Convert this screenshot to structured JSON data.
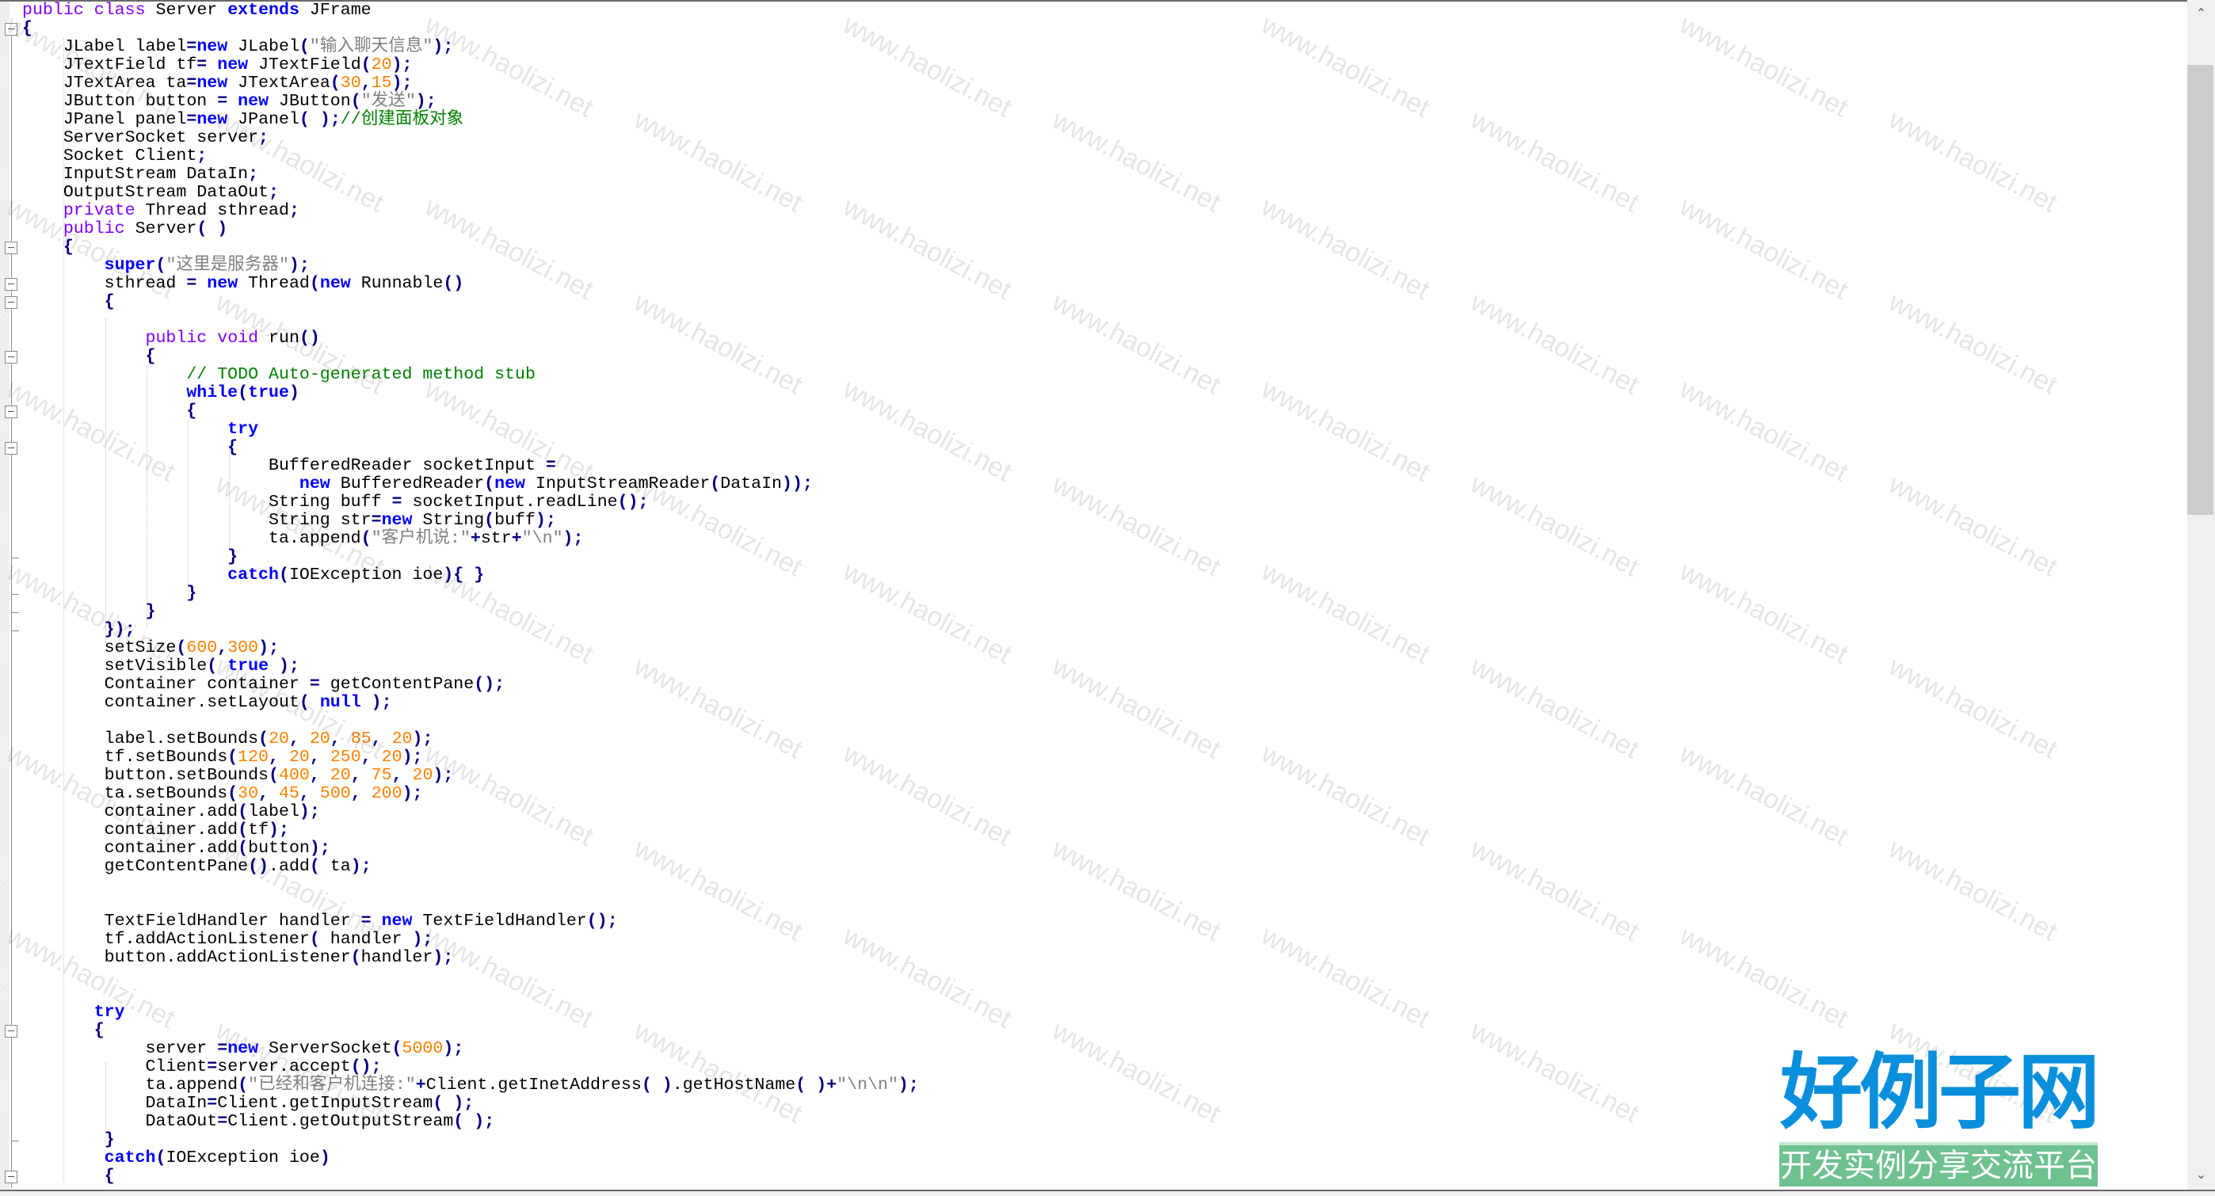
{
  "watermark": "www.haolizi.net",
  "logo": {
    "main": "好例子网",
    "sub": "开发实例分享交流平台"
  },
  "scrollbar": {
    "up_icon": "⌃",
    "down_icon": "⌄",
    "thumb_start": 0.05,
    "thumb_fraction": 0.38
  },
  "colors": {
    "keyword": "#0000ff",
    "modifier": "#8000ff",
    "string": "#808080",
    "number": "#ff8000",
    "comment": "#008000",
    "operator": "#000080"
  },
  "code": {
    "language": "java",
    "lines": [
      "public class Server extends JFrame",
      "{",
      "    JLabel label=new JLabel(\"输入聊天信息\");",
      "    JTextField tf= new JTextField(20);",
      "    JTextArea ta=new JTextArea(30,15);",
      "    JButton button = new JButton(\"发送\");",
      "    JPanel panel=new JPanel( );//创建面板对象",
      "    ServerSocket server;",
      "    Socket Client;",
      "    InputStream DataIn;",
      "    OutputStream DataOut;",
      "    private Thread sthread;",
      "    public Server( )",
      "    {",
      "        super(\"这里是服务器\");",
      "        sthread = new Thread(new Runnable()",
      "        {",
      "",
      "            public void run()",
      "            {",
      "                // TODO Auto-generated method stub",
      "                while(true)",
      "                {",
      "                    try",
      "                    {",
      "                        BufferedReader socketInput =",
      "                           new BufferedReader(new InputStreamReader(DataIn));",
      "                        String buff = socketInput.readLine();",
      "                        String str=new String(buff);",
      "                        ta.append(\"客户机说:\"+str+\"\\n\");",
      "                    }",
      "                    catch(IOException ioe){ }",
      "                }",
      "            }",
      "        });",
      "        setSize(600,300);",
      "        setVisible( true );",
      "        Container container = getContentPane();",
      "        container.setLayout( null );",
      "",
      "        label.setBounds(20, 20, 85, 20);",
      "        tf.setBounds(120, 20, 250, 20);",
      "        button.setBounds(400, 20, 75, 20);",
      "        ta.setBounds(30, 45, 500, 200);",
      "        container.add(label);",
      "        container.add(tf);",
      "        container.add(button);",
      "        getContentPane().add( ta);",
      "",
      "",
      "        TextFieldHandler handler = new TextFieldHandler();",
      "        tf.addActionListener( handler );",
      "        button.addActionListener(handler);",
      "",
      "",
      "       try",
      "       {",
      "            server =new ServerSocket(5000);",
      "            Client=server.accept();",
      "            ta.append(\"已经和客户机连接:\"+Client.getInetAddress( ).getHostName( )+\"\\n\\n\");",
      "            DataIn=Client.getInputStream( );",
      "            DataOut=Client.getOutputStream( );",
      "        }",
      "        catch(IOException ioe)",
      "        {"
    ]
  }
}
